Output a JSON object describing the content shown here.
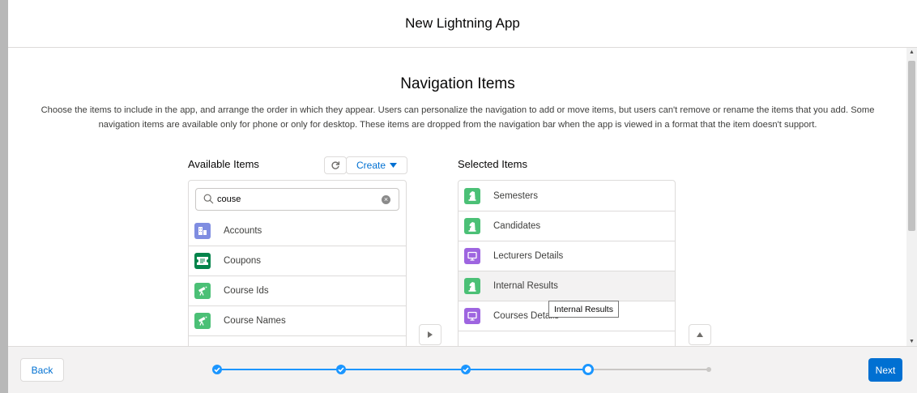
{
  "header": {
    "title": "New Lightning App"
  },
  "section": {
    "title": "Navigation Items",
    "description": "Choose the items to include in the app, and arrange the order in which they appear. Users can personalize the navigation to add or move items, but users can't remove or rename the items that you add. Some navigation items are available only for phone or only for desktop. These items are dropped from the navigation bar when the app is viewed in a format that the item doesn't support."
  },
  "available": {
    "label": "Available Items",
    "create_label": "Create",
    "search_value": "couse",
    "items": [
      {
        "label": "Accounts",
        "icon": "accounts-icon",
        "color": "#7f8de1"
      },
      {
        "label": "Coupons",
        "icon": "coupon-icon",
        "color": "#04844b"
      },
      {
        "label": "Course Ids",
        "icon": "telescope-icon",
        "color": "#4bc076"
      },
      {
        "label": "Course Names",
        "icon": "telescope-icon",
        "color": "#4bc076"
      }
    ]
  },
  "selected": {
    "label": "Selected Items",
    "items": [
      {
        "label": "Semesters",
        "icon": "chess-knight-icon",
        "color": "#4bc076"
      },
      {
        "label": "Candidates",
        "icon": "chess-knight-icon",
        "color": "#4bc076"
      },
      {
        "label": "Lecturers Details",
        "icon": "monitor-icon",
        "color": "#9e65e0"
      },
      {
        "label": "Internal Results",
        "icon": "chess-knight-icon",
        "color": "#4bc076"
      },
      {
        "label": "Courses Details",
        "icon": "monitor-icon",
        "color": "#9e65e0"
      }
    ]
  },
  "tooltip": {
    "text": "Internal Results"
  },
  "footer": {
    "back_label": "Back",
    "next_label": "Next"
  },
  "progress": {
    "total_steps": 5,
    "current_step": 4
  },
  "colors": {
    "brand": "#0070d2",
    "track": "#1b96ff"
  }
}
